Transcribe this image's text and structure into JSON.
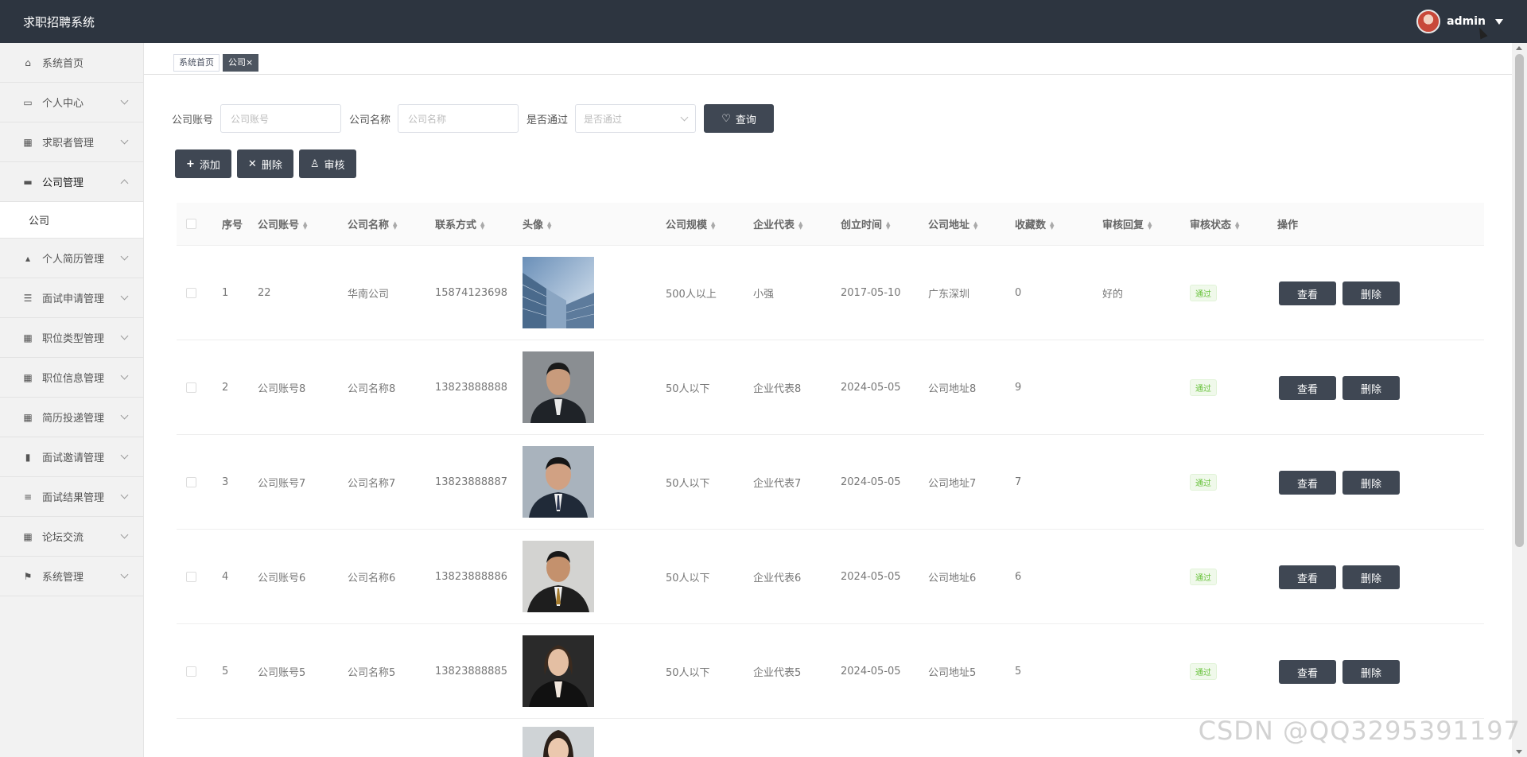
{
  "header": {
    "app_title": "求职招聘系统",
    "user_name": "admin"
  },
  "sidebar": {
    "items": [
      {
        "label": "系统首页",
        "icon": "home-icon",
        "has_arrow": false
      },
      {
        "label": "个人中心",
        "icon": "calendar-icon",
        "has_arrow": true
      },
      {
        "label": "求职者管理",
        "icon": "grid-icon",
        "has_arrow": true
      },
      {
        "label": "公司管理",
        "icon": "monitor-icon",
        "has_arrow": true,
        "expanded": true
      },
      {
        "label": "个人简历管理",
        "icon": "thumb-icon",
        "has_arrow": true
      },
      {
        "label": "面试申请管理",
        "icon": "list-icon",
        "has_arrow": true
      },
      {
        "label": "职位类型管理",
        "icon": "grid-icon",
        "has_arrow": true
      },
      {
        "label": "职位信息管理",
        "icon": "grid-icon",
        "has_arrow": true
      },
      {
        "label": "简历投递管理",
        "icon": "grid-icon",
        "has_arrow": true
      },
      {
        "label": "面试邀请管理",
        "icon": "bar-chart-icon",
        "has_arrow": true
      },
      {
        "label": "面试结果管理",
        "icon": "sliders-icon",
        "has_arrow": true
      },
      {
        "label": "论坛交流",
        "icon": "grid-icon",
        "has_arrow": true
      },
      {
        "label": "系统管理",
        "icon": "flag-icon",
        "has_arrow": true
      }
    ],
    "submenu": {
      "label": "公司"
    }
  },
  "tags": {
    "home": "系统首页",
    "current": "公司×"
  },
  "search": {
    "account_label": "公司账号",
    "account_placeholder": "公司账号",
    "name_label": "公司名称",
    "name_placeholder": "公司名称",
    "pass_label": "是否通过",
    "pass_placeholder": "是否通过",
    "query_label": "查询"
  },
  "actions": {
    "add": "添加",
    "delete": "删除",
    "review": "审核"
  },
  "table": {
    "headers": {
      "index": "序号",
      "account": "公司账号",
      "name": "公司名称",
      "contact": "联系方式",
      "avatar": "头像",
      "scale": "公司规模",
      "rep": "企业代表",
      "founded": "创立时间",
      "address": "公司地址",
      "favorites": "收藏数",
      "reply": "审核回复",
      "status": "审核状态",
      "ops": "操作"
    },
    "rows": [
      {
        "index": "1",
        "account": "22",
        "name": "华南公司",
        "contact": "15874123698",
        "scale": "500人以上",
        "rep": "小强",
        "founded": "2017-05-10",
        "address": "广东深圳",
        "favorites": "0",
        "reply": "好的",
        "status": "通过",
        "image": "building"
      },
      {
        "index": "2",
        "account": "公司账号8",
        "name": "公司名称8",
        "contact": "13823888888",
        "scale": "50人以下",
        "rep": "企业代表8",
        "founded": "2024-05-05",
        "address": "公司地址8",
        "favorites": "9",
        "reply": "",
        "status": "通过",
        "image": "man1"
      },
      {
        "index": "3",
        "account": "公司账号7",
        "name": "公司名称7",
        "contact": "13823888887",
        "scale": "50人以下",
        "rep": "企业代表7",
        "founded": "2024-05-05",
        "address": "公司地址7",
        "favorites": "7",
        "reply": "",
        "status": "通过",
        "image": "man2"
      },
      {
        "index": "4",
        "account": "公司账号6",
        "name": "公司名称6",
        "contact": "13823888886",
        "scale": "50人以下",
        "rep": "企业代表6",
        "founded": "2024-05-05",
        "address": "公司地址6",
        "favorites": "6",
        "reply": "",
        "status": "通过",
        "image": "man3"
      },
      {
        "index": "5",
        "account": "公司账号5",
        "name": "公司名称5",
        "contact": "13823888885",
        "scale": "50人以下",
        "rep": "企业代表5",
        "founded": "2024-05-05",
        "address": "公司地址5",
        "favorites": "5",
        "reply": "",
        "status": "通过",
        "image": "woman1"
      }
    ],
    "view_label": "查看",
    "delete_label": "删除"
  },
  "watermark": "CSDN @QQ3295391197",
  "colors": {
    "header_bg": "#2d3540",
    "button_bg": "#3f4753",
    "status_green": "#67c23a"
  }
}
